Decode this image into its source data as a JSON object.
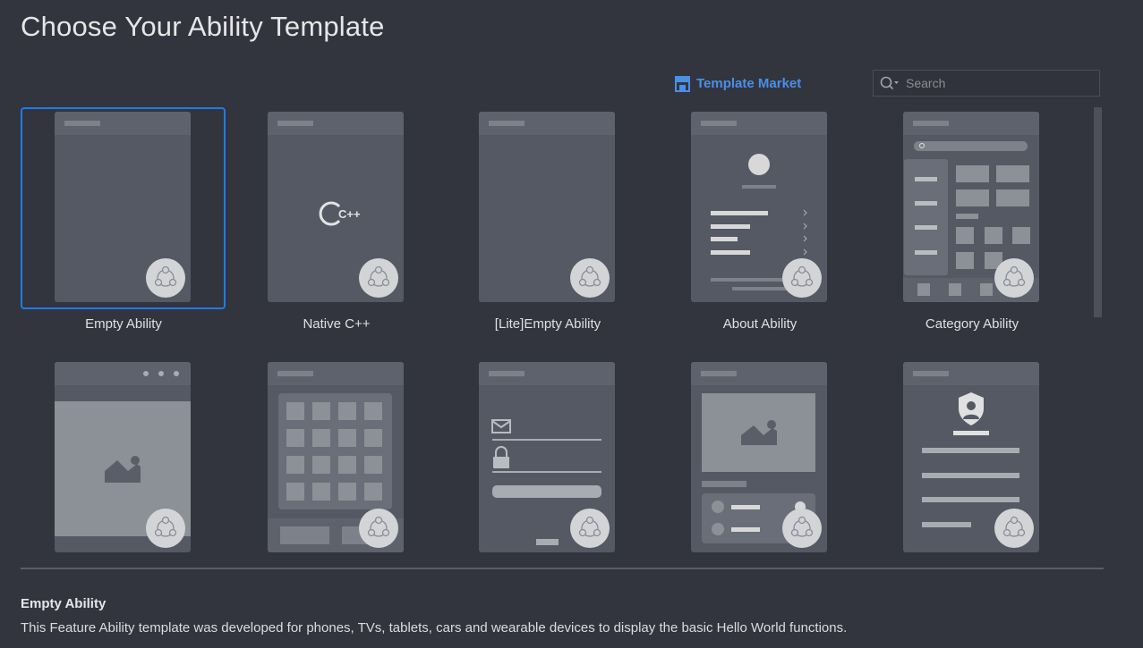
{
  "header": {
    "title": "Choose Your Ability Template",
    "template_market_label": "Template Market",
    "accent_color": "#4a8fe8"
  },
  "search": {
    "placeholder": "Search",
    "value": ""
  },
  "templates": [
    {
      "label": "Empty Ability",
      "selected": true,
      "preview": "empty"
    },
    {
      "label": "Native C++",
      "selected": false,
      "preview": "cpp",
      "icon_text": "C++"
    },
    {
      "label": "[Lite]Empty Ability",
      "selected": false,
      "preview": "empty"
    },
    {
      "label": "About Ability",
      "selected": false,
      "preview": "about"
    },
    {
      "label": "Category Ability",
      "selected": false,
      "preview": "category"
    },
    {
      "label": "",
      "selected": false,
      "preview": "image-viewer"
    },
    {
      "label": "",
      "selected": false,
      "preview": "grid"
    },
    {
      "label": "",
      "selected": false,
      "preview": "login"
    },
    {
      "label": "",
      "selected": false,
      "preview": "detail"
    },
    {
      "label": "",
      "selected": false,
      "preview": "privacy"
    }
  ],
  "selection_color": "#1f7be8",
  "description": {
    "title": "Empty Ability",
    "text": "This Feature Ability template was developed for phones, TVs, tablets, cars and wearable devices to display the basic Hello World functions."
  }
}
